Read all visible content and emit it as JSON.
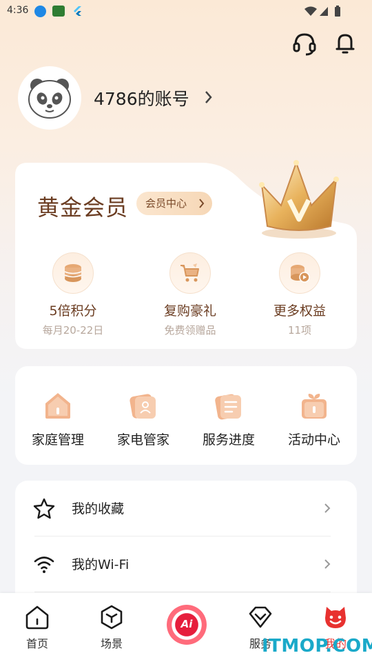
{
  "status_bar": {
    "time": "4:36"
  },
  "header": {
    "account_name": "4786的账号"
  },
  "vip": {
    "title": "黄金会员",
    "center_button": "会员中心",
    "perks": [
      {
        "title": "5倍积分",
        "subtitle": "每月20-22日",
        "icon": "coins-stack-icon"
      },
      {
        "title": "复购豪礼",
        "subtitle": "免费领赠品",
        "icon": "shopping-cart-icon"
      },
      {
        "title": "更多权益",
        "subtitle": "11项",
        "icon": "coins-more-icon"
      }
    ]
  },
  "quick_actions": [
    {
      "label": "家庭管理",
      "icon": "home-icon"
    },
    {
      "label": "家电管家",
      "icon": "appliance-card-icon"
    },
    {
      "label": "服务进度",
      "icon": "document-progress-icon"
    },
    {
      "label": "活动中心",
      "icon": "gift-icon"
    }
  ],
  "menu": [
    {
      "label": "我的收藏",
      "icon": "star-icon"
    },
    {
      "label": "我的Wi-Fi",
      "icon": "wifi-icon"
    }
  ],
  "tabs": [
    {
      "label": "首页",
      "icon": "home-tab-icon"
    },
    {
      "label": "场景",
      "icon": "scene-cube-icon"
    },
    {
      "label": "Ai",
      "icon": "ai-assistant-icon"
    },
    {
      "label": "服务",
      "icon": "service-diamond-icon"
    },
    {
      "label": "我的",
      "icon": "profile-face-icon",
      "active": true
    }
  ],
  "watermark": "ITMOP.COM",
  "colors": {
    "accent_red": "#e8312f",
    "gold_text": "#6b3d22",
    "background": "#f3f4f7"
  }
}
